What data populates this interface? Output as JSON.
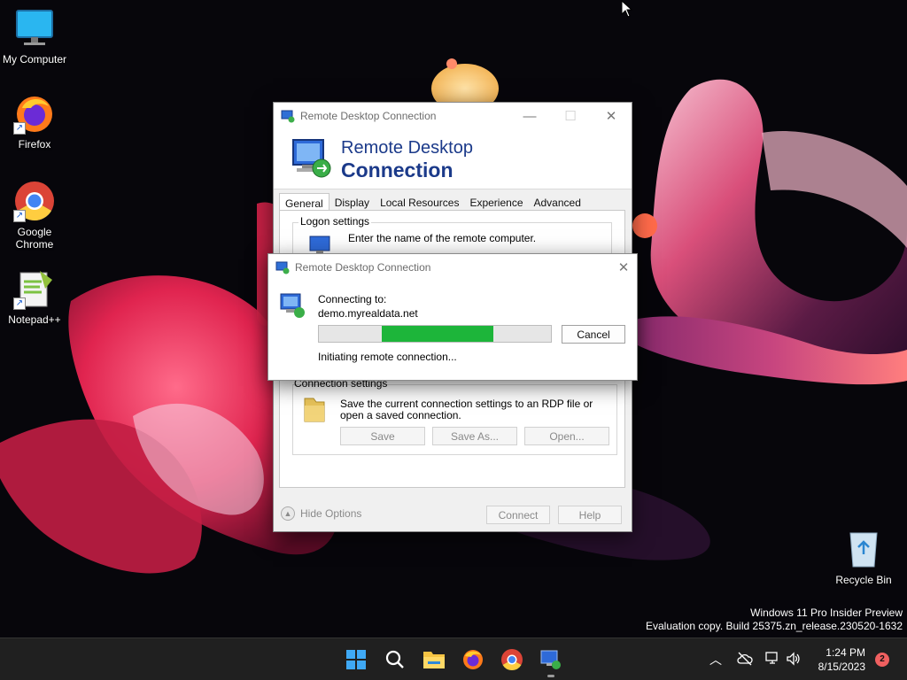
{
  "desktop": {
    "icons": [
      {
        "label": "My Computer"
      },
      {
        "label": "Firefox"
      },
      {
        "label": "Google Chrome"
      },
      {
        "label": "Notepad++"
      },
      {
        "label": "Recycle Bin"
      }
    ],
    "watermark": {
      "line1": "Windows 11 Pro Insider Preview",
      "line2": "Evaluation copy. Build 25375.zn_release.230520-1632"
    }
  },
  "rdp_window": {
    "title": "Remote Desktop Connection",
    "banner_line1": "Remote Desktop",
    "banner_line2": "Connection",
    "tabs": [
      "General",
      "Display",
      "Local Resources",
      "Experience",
      "Advanced"
    ],
    "active_tab": "General",
    "logon_settings": {
      "heading": "Logon settings",
      "prompt": "Enter the name of the remote computer."
    },
    "connection_settings": {
      "heading": "Connection settings",
      "description": "Save the current connection settings to an RDP file or open a saved connection.",
      "save_label": "Save",
      "save_as_label": "Save As...",
      "open_label": "Open..."
    },
    "hide_options_label": "Hide Options",
    "connect_label": "Connect",
    "help_label": "Help"
  },
  "progress_dialog": {
    "title": "Remote Desktop Connection",
    "connecting_to_label": "Connecting to:",
    "host": "demo.myrealdata.net",
    "status": "Initiating remote connection...",
    "cancel_label": "Cancel",
    "progress_fill_start": 0.27,
    "progress_fill_end": 0.75
  },
  "taskbar": {
    "time": "1:24 PM",
    "date": "8/15/2023",
    "notification_count": "2",
    "icons": [
      "start-icon",
      "search-icon",
      "file-explorer-icon",
      "firefox-icon",
      "chrome-icon",
      "remote-desktop-icon"
    ]
  },
  "colors": {
    "progress": "#1db53a",
    "banner_text": "#1b3a8a",
    "taskbar": "#202020"
  }
}
